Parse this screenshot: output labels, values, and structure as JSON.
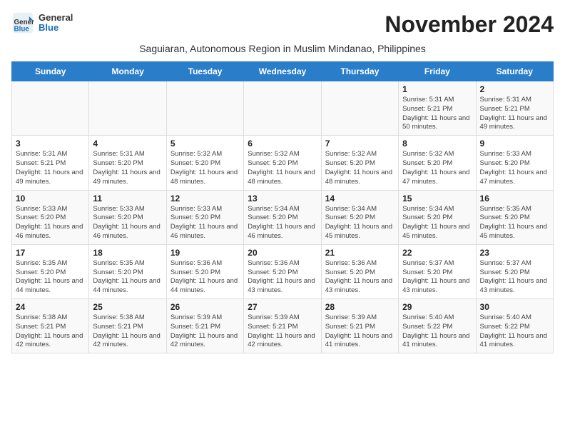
{
  "logo": {
    "general": "General",
    "blue": "Blue"
  },
  "header": {
    "month": "November 2024",
    "subtitle": "Saguiaran, Autonomous Region in Muslim Mindanao, Philippines"
  },
  "weekdays": [
    "Sunday",
    "Monday",
    "Tuesday",
    "Wednesday",
    "Thursday",
    "Friday",
    "Saturday"
  ],
  "weeks": [
    [
      {
        "day": "",
        "info": ""
      },
      {
        "day": "",
        "info": ""
      },
      {
        "day": "",
        "info": ""
      },
      {
        "day": "",
        "info": ""
      },
      {
        "day": "",
        "info": ""
      },
      {
        "day": "1",
        "info": "Sunrise: 5:31 AM\nSunset: 5:21 PM\nDaylight: 11 hours and 50 minutes."
      },
      {
        "day": "2",
        "info": "Sunrise: 5:31 AM\nSunset: 5:21 PM\nDaylight: 11 hours and 49 minutes."
      }
    ],
    [
      {
        "day": "3",
        "info": "Sunrise: 5:31 AM\nSunset: 5:21 PM\nDaylight: 11 hours and 49 minutes."
      },
      {
        "day": "4",
        "info": "Sunrise: 5:31 AM\nSunset: 5:20 PM\nDaylight: 11 hours and 49 minutes."
      },
      {
        "day": "5",
        "info": "Sunrise: 5:32 AM\nSunset: 5:20 PM\nDaylight: 11 hours and 48 minutes."
      },
      {
        "day": "6",
        "info": "Sunrise: 5:32 AM\nSunset: 5:20 PM\nDaylight: 11 hours and 48 minutes."
      },
      {
        "day": "7",
        "info": "Sunrise: 5:32 AM\nSunset: 5:20 PM\nDaylight: 11 hours and 48 minutes."
      },
      {
        "day": "8",
        "info": "Sunrise: 5:32 AM\nSunset: 5:20 PM\nDaylight: 11 hours and 47 minutes."
      },
      {
        "day": "9",
        "info": "Sunrise: 5:33 AM\nSunset: 5:20 PM\nDaylight: 11 hours and 47 minutes."
      }
    ],
    [
      {
        "day": "10",
        "info": "Sunrise: 5:33 AM\nSunset: 5:20 PM\nDaylight: 11 hours and 46 minutes."
      },
      {
        "day": "11",
        "info": "Sunrise: 5:33 AM\nSunset: 5:20 PM\nDaylight: 11 hours and 46 minutes."
      },
      {
        "day": "12",
        "info": "Sunrise: 5:33 AM\nSunset: 5:20 PM\nDaylight: 11 hours and 46 minutes."
      },
      {
        "day": "13",
        "info": "Sunrise: 5:34 AM\nSunset: 5:20 PM\nDaylight: 11 hours and 46 minutes."
      },
      {
        "day": "14",
        "info": "Sunrise: 5:34 AM\nSunset: 5:20 PM\nDaylight: 11 hours and 45 minutes."
      },
      {
        "day": "15",
        "info": "Sunrise: 5:34 AM\nSunset: 5:20 PM\nDaylight: 11 hours and 45 minutes."
      },
      {
        "day": "16",
        "info": "Sunrise: 5:35 AM\nSunset: 5:20 PM\nDaylight: 11 hours and 45 minutes."
      }
    ],
    [
      {
        "day": "17",
        "info": "Sunrise: 5:35 AM\nSunset: 5:20 PM\nDaylight: 11 hours and 44 minutes."
      },
      {
        "day": "18",
        "info": "Sunrise: 5:35 AM\nSunset: 5:20 PM\nDaylight: 11 hours and 44 minutes."
      },
      {
        "day": "19",
        "info": "Sunrise: 5:36 AM\nSunset: 5:20 PM\nDaylight: 11 hours and 44 minutes."
      },
      {
        "day": "20",
        "info": "Sunrise: 5:36 AM\nSunset: 5:20 PM\nDaylight: 11 hours and 43 minutes."
      },
      {
        "day": "21",
        "info": "Sunrise: 5:36 AM\nSunset: 5:20 PM\nDaylight: 11 hours and 43 minutes."
      },
      {
        "day": "22",
        "info": "Sunrise: 5:37 AM\nSunset: 5:20 PM\nDaylight: 11 hours and 43 minutes."
      },
      {
        "day": "23",
        "info": "Sunrise: 5:37 AM\nSunset: 5:20 PM\nDaylight: 11 hours and 43 minutes."
      }
    ],
    [
      {
        "day": "24",
        "info": "Sunrise: 5:38 AM\nSunset: 5:21 PM\nDaylight: 11 hours and 42 minutes."
      },
      {
        "day": "25",
        "info": "Sunrise: 5:38 AM\nSunset: 5:21 PM\nDaylight: 11 hours and 42 minutes."
      },
      {
        "day": "26",
        "info": "Sunrise: 5:39 AM\nSunset: 5:21 PM\nDaylight: 11 hours and 42 minutes."
      },
      {
        "day": "27",
        "info": "Sunrise: 5:39 AM\nSunset: 5:21 PM\nDaylight: 11 hours and 42 minutes."
      },
      {
        "day": "28",
        "info": "Sunrise: 5:39 AM\nSunset: 5:21 PM\nDaylight: 11 hours and 41 minutes."
      },
      {
        "day": "29",
        "info": "Sunrise: 5:40 AM\nSunset: 5:22 PM\nDaylight: 11 hours and 41 minutes."
      },
      {
        "day": "30",
        "info": "Sunrise: 5:40 AM\nSunset: 5:22 PM\nDaylight: 11 hours and 41 minutes."
      }
    ]
  ]
}
